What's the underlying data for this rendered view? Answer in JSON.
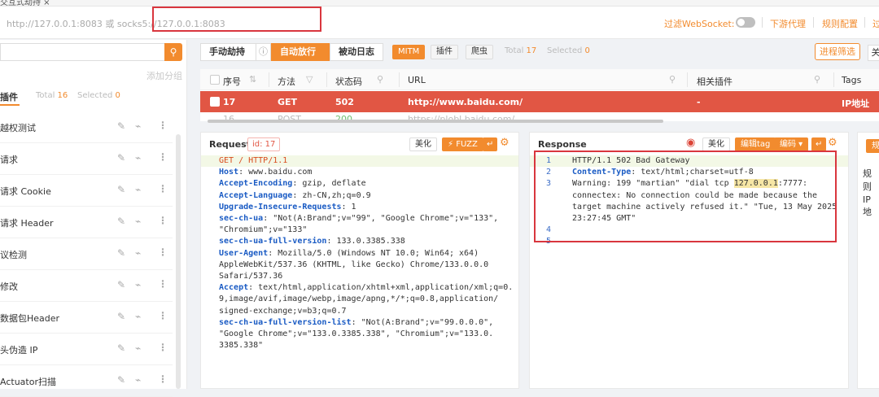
{
  "top_tab": "交互式劫持 ×",
  "address": {
    "placeholder": "http://127.0.0.1:8083 或 socks5://127.0.0.1:8083"
  },
  "header": {
    "ws_label": "过滤WebSocket:",
    "downstream_proxy": "下游代理",
    "rule_config": "规则配置",
    "filter_cut": "过"
  },
  "left": {
    "search_icon": "search-icon",
    "add_group": "添加分组",
    "tab_label": "插件",
    "total_label": "Total",
    "total_value": "16",
    "selected_label": "Selected",
    "selected_value": "0",
    "items": [
      {
        "label": "越权测试"
      },
      {
        "label": "请求"
      },
      {
        "label": "请求 Cookie"
      },
      {
        "label": "请求 Header"
      },
      {
        "label": "议检测"
      },
      {
        "label": "修改"
      },
      {
        "label": "数据包Header"
      },
      {
        "label": "头伪造 IP"
      },
      {
        "label": "Actuator扫描"
      }
    ]
  },
  "toolbar": {
    "manual": "手动劫持",
    "auto": "自动放行",
    "passive": "被动日志",
    "mitm": "MITM",
    "plugin": "插件",
    "crawler": "爬虫",
    "total_label": "Total",
    "total_value": "17",
    "selected_label": "Selected",
    "selected_value": "0",
    "process_filter": "进程筛选",
    "close": "关"
  },
  "table": {
    "headers": {
      "seq": "序号",
      "method": "方法",
      "status": "状态码",
      "url": "URL",
      "plugins": "相关插件",
      "tags": "Tags"
    },
    "row": {
      "seq": "17",
      "method": "GET",
      "status": "502",
      "url": "http://www.baidu.com/",
      "plugins": "-",
      "tags": "IP地址"
    },
    "row2": {
      "seq": "16",
      "method": "POST",
      "status": "200",
      "url": "https://plobl.baidu.com/..."
    }
  },
  "request": {
    "title": "Request",
    "id_tag": "id: 17",
    "beautify": "美化",
    "fuzz": "⚡ FUZZ",
    "lines": [
      {
        "k": "GET",
        "v": " / HTTP/1.1"
      },
      {
        "k": "Host",
        "v": ": www.baidu.com"
      },
      {
        "k": "Accept-Encoding",
        "v": ": gzip, deflate"
      },
      {
        "k": "Accept-Language",
        "v": ": zh-CN,zh;q=0.9"
      },
      {
        "k": "Upgrade-Insecure-Requests",
        "v": ": 1"
      },
      {
        "k": "sec-ch-ua",
        "v": ": \"Not(A:Brand\";v=\"99\", \"Google Chrome\";v=\"133\","
      },
      {
        "k": "",
        "v": "\"Chromium\";v=\"133\""
      },
      {
        "k": "sec-ch-ua-full-version",
        "v": ": 133.0.3385.338"
      },
      {
        "k": "User-Agent",
        "v": ": Mozilla/5.0 (Windows NT 10.0; Win64; x64)"
      },
      {
        "k": "",
        "v": "AppleWebKit/537.36 (KHTML, like Gecko) Chrome/133.0.0.0"
      },
      {
        "k": "",
        "v": "Safari/537.36"
      },
      {
        "k": "Accept",
        "v": ": text/html,application/xhtml+xml,application/xml;q=0."
      },
      {
        "k": "",
        "v": "9,image/avif,image/webp,image/apng,*/*;q=0.8,application/"
      },
      {
        "k": "",
        "v": "signed-exchange;v=b3;q=0.7"
      },
      {
        "k": "sec-ch-ua-full-version-list",
        "v": ": \"Not(A:Brand\";v=\"99.0.0.0\","
      },
      {
        "k": "",
        "v": "\"Google Chrome\";v=\"133.0.3385.338\", \"Chromium\";v=\"133.0."
      },
      {
        "k": "",
        "v": "3385.338\""
      }
    ]
  },
  "response": {
    "title": "Response",
    "beautify": "美化",
    "edit_tag": "编辑tag",
    "encode": "编码 ▾",
    "lines": [
      {
        "n": "1",
        "k": "",
        "v": "HTTP/1.1 502 Bad Gateway"
      },
      {
        "n": "2",
        "k": "Content-Type",
        "v": ": text/html;charset=utf-8"
      },
      {
        "n": "3",
        "k": "",
        "v": "Warning: 199 \"martian\" \"dial tcp ",
        "hl": "127.0.0.1",
        "v2": ":7777:"
      },
      {
        "n": "",
        "k": "",
        "v": "connectex: No connection could be made because the"
      },
      {
        "n": "",
        "k": "",
        "v": "target machine actively refused it.\" \"Tue, 13 May 2025"
      },
      {
        "n": "",
        "k": "",
        "v": "23:27:45 GMT\""
      },
      {
        "n": "4",
        "k": "",
        "v": ""
      },
      {
        "n": "5",
        "k": "",
        "v": ""
      }
    ]
  },
  "right_panel": {
    "btn": "规",
    "item1": "规则",
    "item2": "IP地"
  }
}
